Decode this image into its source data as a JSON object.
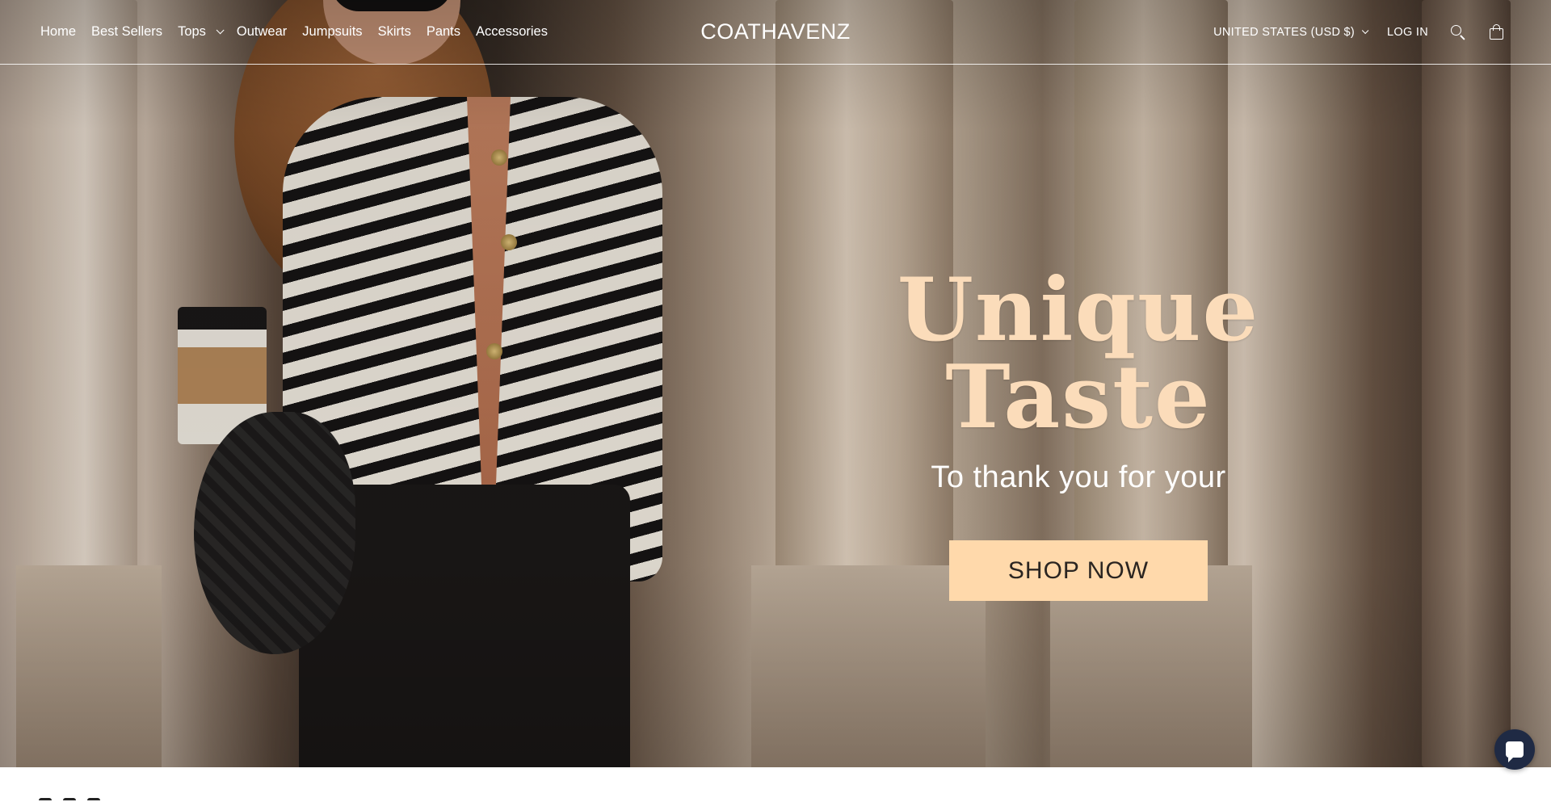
{
  "header": {
    "nav": [
      {
        "label": "Home",
        "has_dropdown": false
      },
      {
        "label": "Best Sellers",
        "has_dropdown": false
      },
      {
        "label": "Tops",
        "has_dropdown": true
      },
      {
        "label": "Outwear",
        "has_dropdown": false
      },
      {
        "label": "Jumpsuits",
        "has_dropdown": false
      },
      {
        "label": "Skirts",
        "has_dropdown": false
      },
      {
        "label": "Pants",
        "has_dropdown": false
      },
      {
        "label": "Accessories",
        "has_dropdown": false
      }
    ],
    "logo": "COATHAVENZ",
    "currency": "UNITED STATES (USD $)",
    "login": "LOG IN",
    "icons": {
      "search": "search-icon",
      "cart": "cart-icon"
    }
  },
  "hero": {
    "headline": "Unique Taste",
    "subline": "To thank you for your",
    "cta": "SHOP NOW",
    "colors": {
      "headline": "#fbdcba",
      "cta_bg": "#ffd9ab",
      "cta_text": "#2a2521"
    }
  },
  "chat": {
    "icon": "chat-icon",
    "color": "#1f2a44"
  }
}
